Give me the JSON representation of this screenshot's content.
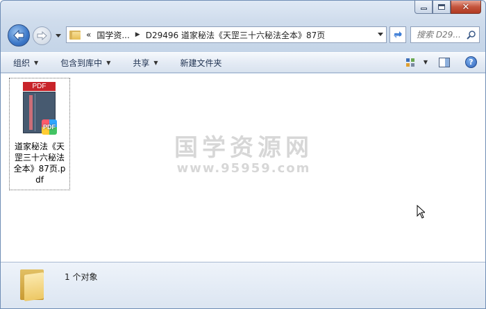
{
  "window": {
    "caption": {
      "minimize": "—",
      "maximize": "□",
      "close": "✕"
    }
  },
  "nav": {
    "address_prefix": "«",
    "breadcrumb": [
      "国学资...",
      "D29496 道家秘法《天罡三十六秘法全本》87页"
    ],
    "breadcrumb_separator": "▶",
    "search_placeholder": "搜索 D29..."
  },
  "toolbar": {
    "items": [
      {
        "label": "组织",
        "dropdown": true
      },
      {
        "label": "包含到库中",
        "dropdown": true
      },
      {
        "label": "共享",
        "dropdown": true
      },
      {
        "label": "新建文件夹",
        "dropdown": false
      }
    ]
  },
  "files": [
    {
      "name": "道家秘法《天罡三十六秘法全本》87页.pdf",
      "type_label": "PDF",
      "badge": "PDF"
    }
  ],
  "watermark": {
    "title": "国学资源网",
    "url": "www.95959.com"
  },
  "details": {
    "count_text": "1 个对象"
  },
  "colors": {
    "pdf_red": "#c8242a",
    "accent_blue": "#3c78c8"
  }
}
